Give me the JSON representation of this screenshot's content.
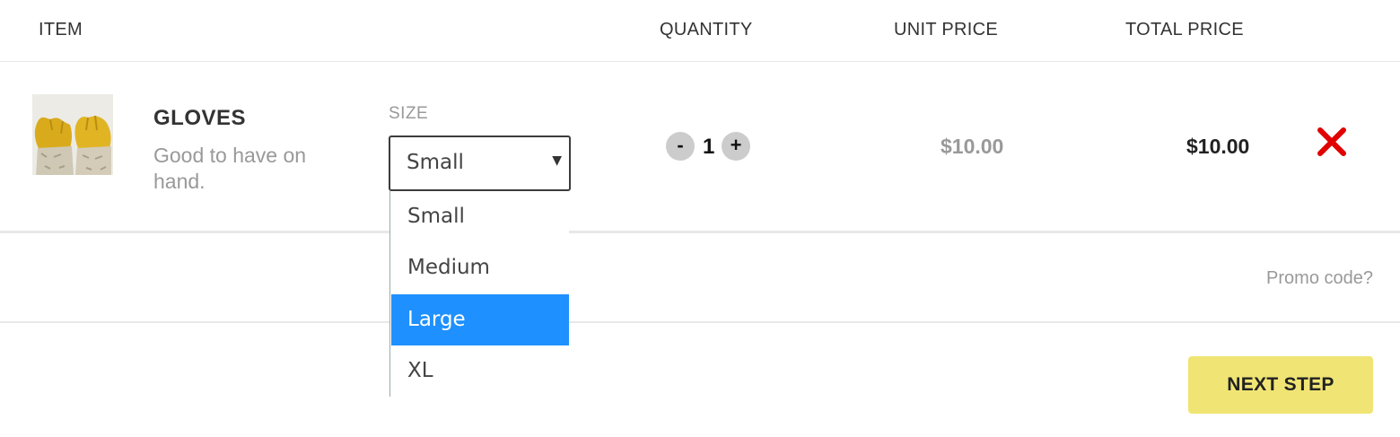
{
  "table_header": {
    "item": "ITEM",
    "quantity": "QUANTITY",
    "unit_price": "UNIT PRICE",
    "total_price": "TOTAL PRICE"
  },
  "cart_item": {
    "name": "GLOVES",
    "description": "Good to have on hand.",
    "image_icon": "gloves-photo",
    "size_label": "SIZE",
    "size_selected": "Small",
    "size_options": [
      "Small",
      "Medium",
      "Large",
      "XL"
    ],
    "size_highlighted": "Large",
    "quantity": "1",
    "decrement_label": "-",
    "increment_label": "+",
    "unit_price": "$10.00",
    "total_price": "$10.00",
    "remove_icon": "close-x-icon"
  },
  "footer": {
    "promo_link": "Promo code?",
    "next_button": "NEXT STEP"
  },
  "colors": {
    "highlight": "#1e90ff",
    "next_button_bg": "#f0e574",
    "remove": "#e00000",
    "muted_text": "#999999"
  }
}
